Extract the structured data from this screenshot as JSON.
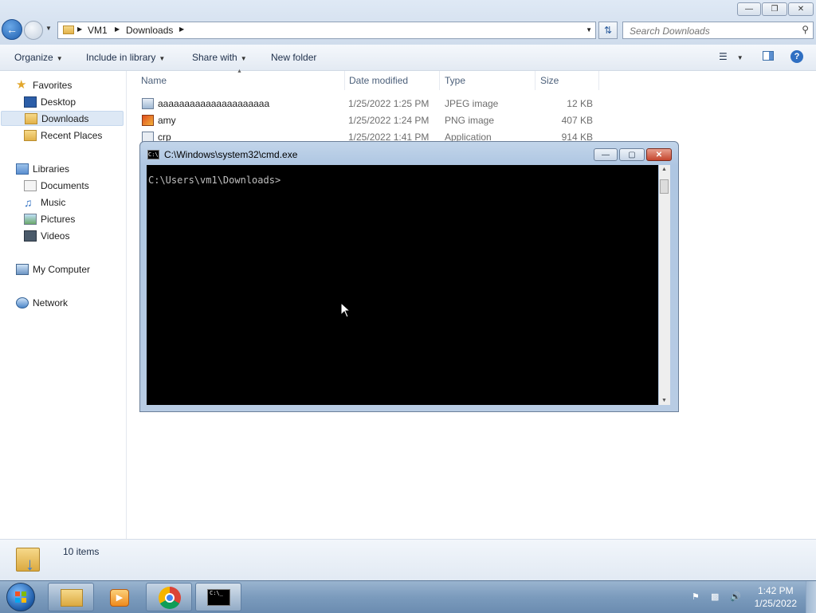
{
  "window": {
    "breadcrumb": [
      "VM1",
      "Downloads"
    ],
    "search_placeholder": "Search Downloads"
  },
  "toolbar": {
    "organize": "Organize",
    "include_in_library": "Include in library",
    "share_with": "Share with",
    "new_folder": "New folder"
  },
  "nav": {
    "favorites": "Favorites",
    "desktop": "Desktop",
    "downloads": "Downloads",
    "recent_places": "Recent Places",
    "libraries": "Libraries",
    "documents": "Documents",
    "music": "Music",
    "pictures": "Pictures",
    "videos": "Videos",
    "my_computer": "My Computer",
    "network": "Network"
  },
  "columns": {
    "name": "Name",
    "date_modified": "Date modified",
    "type": "Type",
    "size": "Size"
  },
  "files": [
    {
      "name": "aaaaaaaaaaaaaaaaaaaaa",
      "date": "1/25/2022 1:25 PM",
      "type": "JPEG image",
      "size": "12 KB"
    },
    {
      "name": "amy",
      "date": "1/25/2022 1:24 PM",
      "type": "PNG image",
      "size": "407 KB"
    },
    {
      "name": "crp",
      "date": "1/25/2022 1:41 PM",
      "type": "Application",
      "size": "914 KB"
    }
  ],
  "status": {
    "item_count": "10 items"
  },
  "cmd": {
    "title": "C:\\Windows\\system32\\cmd.exe",
    "prompt": "C:\\Users\\vm1\\Downloads>"
  },
  "taskbar": {
    "time": "1:42 PM",
    "date": "1/25/2022"
  },
  "colors": {
    "titlebar": "#cfdcec",
    "selection": "#dde8f5",
    "console_bg": "#000000",
    "console_fg": "#c0c0c0",
    "taskbar": "#7b9bbd"
  }
}
